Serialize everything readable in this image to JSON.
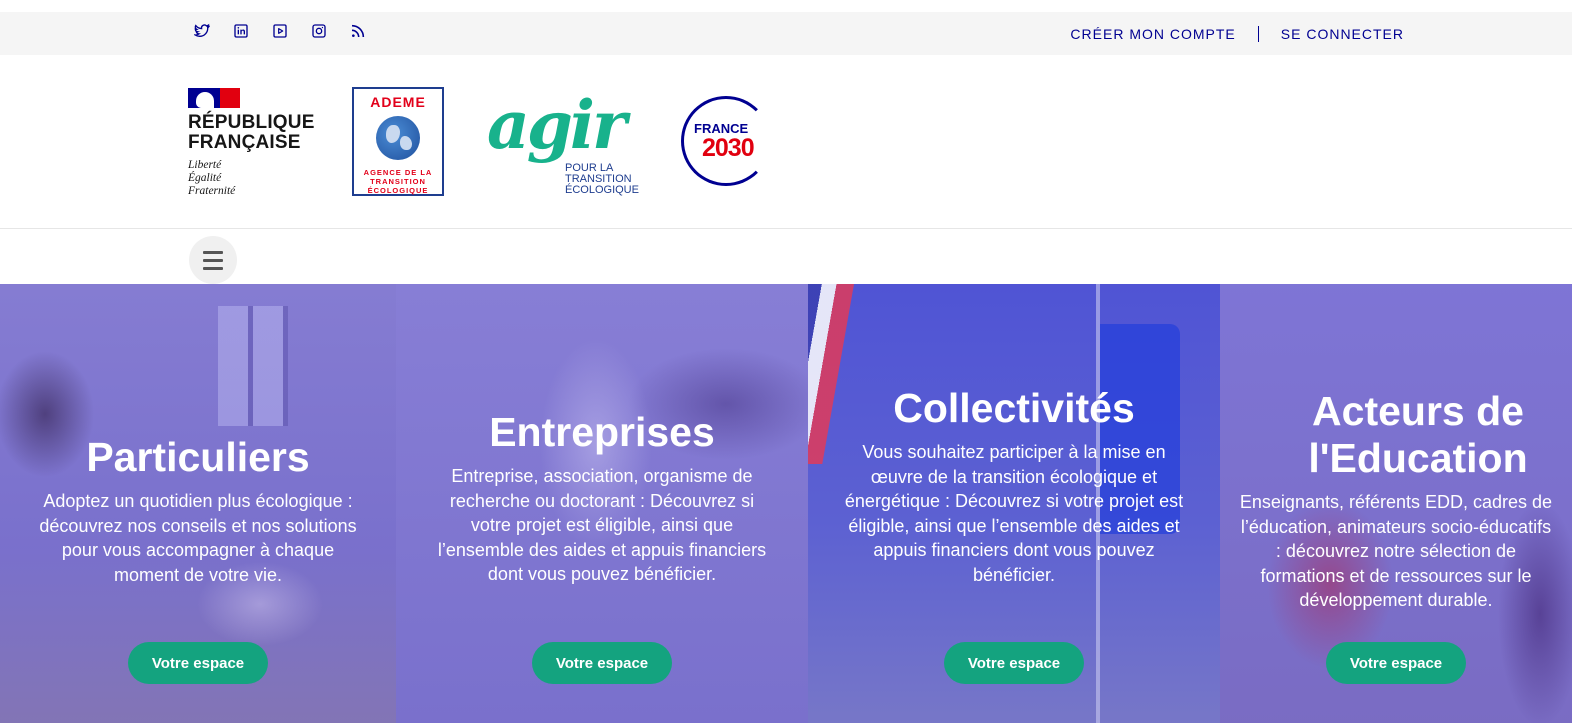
{
  "topbar": {
    "social": [
      {
        "icon": "twitter-icon"
      },
      {
        "icon": "linkedin-icon"
      },
      {
        "icon": "youtube-icon"
      },
      {
        "icon": "instagram-icon"
      },
      {
        "icon": "rss-icon"
      }
    ],
    "create_account": "CRÉER MON COMPTE",
    "login": "SE CONNECTER"
  },
  "logos": {
    "republique": {
      "line1": "RÉPUBLIQUE",
      "line2": "FRANÇAISE",
      "motto1": "Liberté",
      "motto2": "Égalité",
      "motto3": "Fraternité"
    },
    "ademe": {
      "title": "ADEME",
      "sub1": "AGENCE DE LA",
      "sub2": "TRANSITION",
      "sub3": "ÉCOLOGIQUE"
    },
    "agir": {
      "word": "agir",
      "sub1": "POUR LA",
      "sub2": "TRANSITION",
      "sub3": "ÉCOLOGIQUE"
    },
    "france2030": {
      "label": "FRANCE",
      "year": "2030"
    }
  },
  "colors": {
    "brand_blue": "#000091",
    "button_green": "#14a37f",
    "marianne_red": "#e1000f"
  },
  "hero": {
    "panels": [
      {
        "title": "Particuliers",
        "text": "Adoptez un quotidien plus écologique : découvrez nos conseils et nos solutions pour vous accompagner à chaque moment de votre vie.",
        "button": "Votre espace"
      },
      {
        "title": "Entreprises",
        "text": "Entreprise, association, organisme de recherche ou doctorant : Découvrez si votre projet est éligible, ainsi que l’ensemble des aides et appuis financiers dont vous pouvez bénéficier.",
        "button": "Votre espace"
      },
      {
        "title": "Collectivités",
        "text": "Vous souhaitez participer à la mise en œuvre de la transition écologique et énergétique : Découvrez si votre projet est éligible, ainsi que l’ensemble des aides et appuis financiers dont vous pouvez bénéficier.",
        "button": "Votre espace"
      },
      {
        "title": "Acteurs de l'Education",
        "text": "Enseignants, référents EDD, cadres de l’éducation, animateurs socio-éducatifs : découvrez notre sélection de formations et de ressources sur le développement durable.",
        "button": "Votre espace"
      }
    ]
  }
}
